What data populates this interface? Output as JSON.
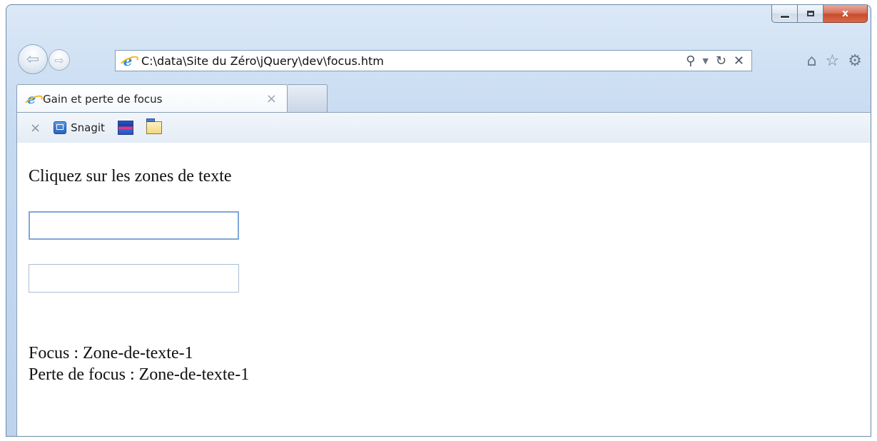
{
  "window": {
    "caption_buttons": {
      "minimize": "",
      "maximize": "",
      "close": "x"
    }
  },
  "navigation": {
    "address": "C:\\data\\Site du Zéro\\jQuery\\dev\\focus.htm",
    "address_icons": [
      "search-icon",
      "dropdown-icon",
      "refresh-icon",
      "stop-icon"
    ],
    "right_icons": [
      "home-icon",
      "favorites-icon",
      "tools-gear-icon"
    ]
  },
  "tabs": [
    {
      "label": "Gain et perte de focus",
      "active": true
    }
  ],
  "command_bar": {
    "close_glyph": "×",
    "snagit_label": "Snagit"
  },
  "page": {
    "instruction": "Cliquez sur les zones de texte",
    "fields": [
      {
        "value": "",
        "focused": true
      },
      {
        "value": "",
        "focused": false
      }
    ],
    "status_focus": "Focus : Zone-de-texte-1",
    "status_blur": "Perte de focus : Zone-de-texte-1"
  },
  "colors": {
    "chrome_blue": "#c5d9f0",
    "close_red": "#c84c2d",
    "focus_border": "#7fa8d8"
  }
}
